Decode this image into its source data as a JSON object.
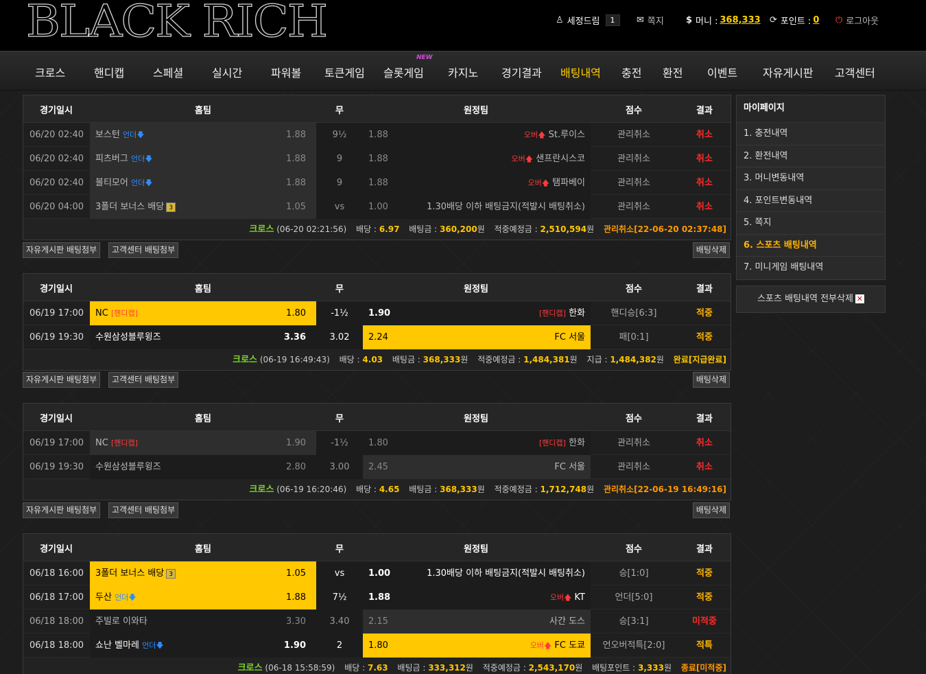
{
  "logo": "BLACK RICH",
  "user": {
    "name": "세정드림",
    "level": "1",
    "messages": "쪽지",
    "money_label": "머니 :",
    "money": "368,333",
    "point_label": "포인트 :",
    "point": "0",
    "logout": "로그아웃"
  },
  "nav": [
    "크로스",
    "핸디캡",
    "스페셜",
    "실시간",
    "파워볼",
    "토큰게임",
    "슬롯게임",
    "카지노",
    "경기결과",
    "배팅내역",
    "충전",
    "환전",
    "이벤트",
    "자유게시판",
    "고객센터"
  ],
  "nav_new": "NEW",
  "headers": {
    "date": "경기일시",
    "home": "홈팀",
    "draw": "무",
    "away": "원정팀",
    "score": "점수",
    "result": "결과"
  },
  "buttons": {
    "free_board": "자유게시판 배팅첨부",
    "cs": "고객센터 배팅첨부",
    "delete": "배팅삭제"
  },
  "tags": {
    "under": "언더",
    "over": "오버",
    "handicap": "[핸디캡]"
  },
  "bets": [
    {
      "rows": [
        {
          "date": "06/20 02:40",
          "home": "보스턴",
          "home_tag": "under",
          "home_odds": "1.88",
          "draw": "9½",
          "away_odds": "1.88",
          "away": "St.루이스",
          "away_tag": "over",
          "score": "관리취소",
          "result": "취소"
        },
        {
          "date": "06/20 02:40",
          "home": "피츠버그",
          "home_tag": "under",
          "home_odds": "1.88",
          "draw": "9",
          "away_odds": "1.88",
          "away": "샌프란시스코",
          "away_tag": "over",
          "score": "관리취소",
          "result": "취소"
        },
        {
          "date": "06/20 02:40",
          "home": "볼티모어",
          "home_tag": "under",
          "home_odds": "1.88",
          "draw": "9",
          "away_odds": "1.88",
          "away": "탬파베이",
          "away_tag": "over",
          "score": "관리취소",
          "result": "취소"
        },
        {
          "date": "06/20 04:00",
          "home": "3폴더 보너스 배당",
          "home_tag": "bonus",
          "home_odds": "1.05",
          "draw": "vs",
          "away_odds": "1.00",
          "away": "1.30배당 이하 배팅금지(적발시 배팅취소)",
          "score": "관리취소",
          "result": "취소"
        }
      ],
      "summary": {
        "type": "크로스",
        "time": "(06-20 02:21:56)",
        "odds_label": "배당 :",
        "odds": "6.97",
        "amount_label": "배팅금 :",
        "amount": "360,200",
        "win_label": "적중예정금 :",
        "win": "2,510,594",
        "won": "원",
        "status": "관리취소[22-06-20 02:37:48]"
      }
    },
    {
      "rows": [
        {
          "date": "06/19 17:00",
          "home": "NC",
          "home_tag": "handicap",
          "home_odds": "1.80",
          "draw": "-1½",
          "away_odds": "1.90",
          "away": "한화",
          "away_tag": "handicap",
          "score": "핸디승[6:3]",
          "result": "적중"
        },
        {
          "date": "06/19 19:30",
          "home": "수원삼성블루윙즈",
          "home_odds": "3.36",
          "draw": "3.02",
          "away_odds": "2.24",
          "away": "FC 서울",
          "score": "패[0:1]",
          "result": "적중"
        }
      ],
      "summary": {
        "type": "크로스",
        "time": "(06-19 16:49:43)",
        "odds_label": "배당 :",
        "odds": "4.03",
        "amount_label": "배팅금 :",
        "amount": "368,333",
        "win_label": "적중예정금 :",
        "win": "1,484,381",
        "won": "원",
        "pay_label": "지급 :",
        "pay": "1,484,382",
        "status": "완료[지급완료]"
      }
    },
    {
      "rows": [
        {
          "date": "06/19 17:00",
          "home": "NC",
          "home_tag": "handicap",
          "home_odds": "1.90",
          "draw": "-1½",
          "away_odds": "1.80",
          "away": "한화",
          "away_tag": "handicap",
          "score": "관리취소",
          "result": "취소"
        },
        {
          "date": "06/19 19:30",
          "home": "수원삼성블루윙즈",
          "home_odds": "2.80",
          "draw": "3.00",
          "away_odds": "2.45",
          "away": "FC 서울",
          "score": "관리취소",
          "result": "취소"
        }
      ],
      "summary": {
        "type": "크로스",
        "time": "(06-19 16:20:46)",
        "odds_label": "배당 :",
        "odds": "4.65",
        "amount_label": "배팅금 :",
        "amount": "368,333",
        "win_label": "적중예정금 :",
        "win": "1,712,748",
        "won": "원",
        "status": "관리취소[22-06-19 16:49:16]"
      }
    },
    {
      "rows": [
        {
          "date": "06/18 16:00",
          "home": "3폴더 보너스 배당",
          "home_tag": "bonus",
          "home_odds": "1.05",
          "draw": "vs",
          "away_odds": "1.00",
          "away": "1.30배당 이하 배팅금지(적발시 배팅취소)",
          "score": "승[1:0]",
          "result": "적중"
        },
        {
          "date": "06/18 17:00",
          "home": "두산",
          "home_tag": "under",
          "home_odds": "1.88",
          "draw": "7½",
          "away_odds": "1.88",
          "away": "KT",
          "away_tag": "over",
          "score": "언더[5:0]",
          "result": "적중"
        },
        {
          "date": "06/18 18:00",
          "home": "주빌로 이와타",
          "home_odds": "3.30",
          "draw": "3.40",
          "away_odds": "2.15",
          "away": "사간 도스",
          "score": "승[3:1]",
          "result": "미적중"
        },
        {
          "date": "06/18 18:00",
          "home": "쇼난 벨마레",
          "home_tag": "under",
          "home_odds": "1.90",
          "draw": "2",
          "away_odds": "1.80",
          "away": "FC 도쿄",
          "away_tag": "over",
          "score": "언오버적특[2:0]",
          "result": "적특"
        }
      ],
      "summary": {
        "type": "크로스",
        "time": "(06-18 15:58:59)",
        "odds_label": "배당 :",
        "odds": "7.63",
        "amount_label": "배팅금 :",
        "amount": "333,312",
        "win_label": "적중예정금 :",
        "win": "2,543,170",
        "won": "원",
        "point_label": "배팅포인트 :",
        "point": "3,333",
        "status": "종료[미적중]"
      }
    }
  ],
  "sidebar": {
    "title": "마이페이지",
    "items": [
      "1. 충전내역",
      "2. 환전내역",
      "3. 머니변동내역",
      "4. 포인트변동내역",
      "5. 쪽지",
      "6. 스포츠 배팅내역",
      "7. 미니게임 배팅내역"
    ],
    "delete_all": "스포츠 배팅내역 전부삭제"
  },
  "colors": {
    "accent": "#ffc800",
    "win": "#ffb400",
    "cancel": "#ff2b2b",
    "cross": "#7fd42a"
  }
}
